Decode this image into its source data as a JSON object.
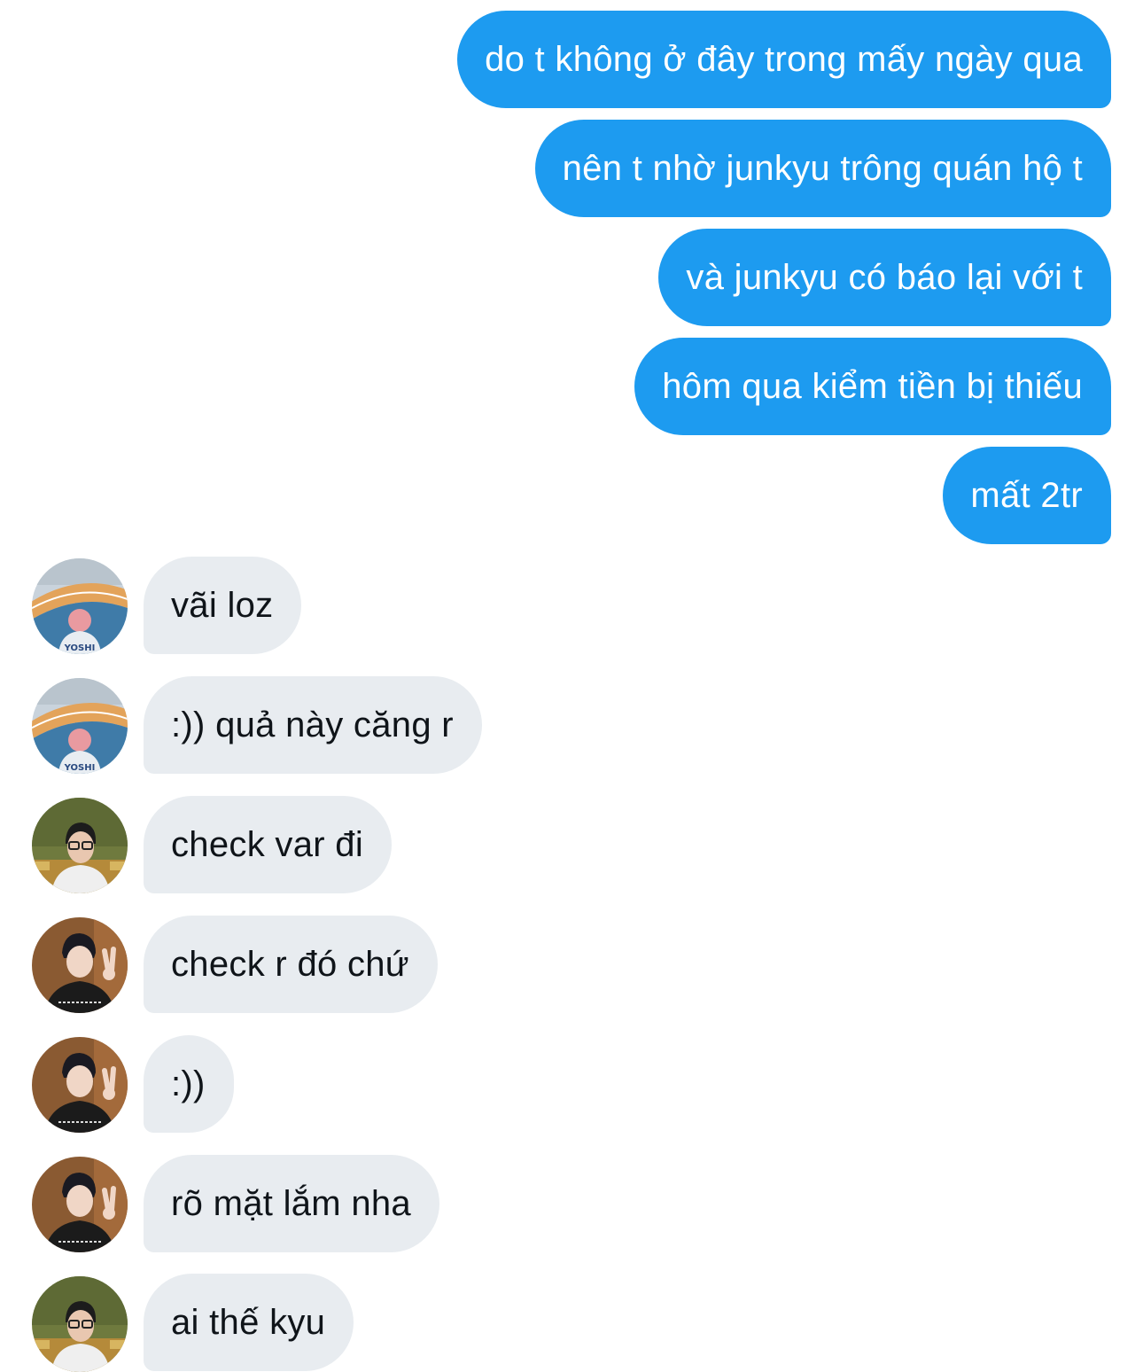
{
  "conversation": {
    "messages": [
      {
        "side": "out",
        "text": "do t không ở đây trong mấy ngày qua"
      },
      {
        "side": "out",
        "text": "nên t nhờ junkyu trông quán hộ t"
      },
      {
        "side": "out",
        "text": "và junkyu có báo lại với t"
      },
      {
        "side": "out",
        "text": "hôm qua kiểm tiền bị thiếu"
      },
      {
        "side": "out",
        "text": "mất 2tr"
      },
      {
        "side": "in",
        "avatar": "stadium-avatar",
        "text": "vãi loz",
        "avatar_caption": "YOSHI"
      },
      {
        "side": "in",
        "avatar": "stadium-avatar",
        "text": ":)) quả này căng r",
        "avatar_caption": "YOSHI"
      },
      {
        "side": "in",
        "avatar": "glasses-avatar",
        "text": "check var đi"
      },
      {
        "side": "in",
        "avatar": "peace-sign-avatar",
        "text": "check r đó chứ"
      },
      {
        "side": "in",
        "avatar": "peace-sign-avatar",
        "text": ":))"
      },
      {
        "side": "in",
        "avatar": "peace-sign-avatar",
        "text": "rõ mặt lắm nha"
      },
      {
        "side": "in",
        "avatar": "glasses-avatar",
        "text": "ai thế kyu"
      }
    ]
  },
  "colors": {
    "outgoing_bubble": "#1d9bf0",
    "incoming_bubble": "#e8ecf0",
    "outgoing_text": "#ffffff",
    "incoming_text": "#0f1419"
  }
}
